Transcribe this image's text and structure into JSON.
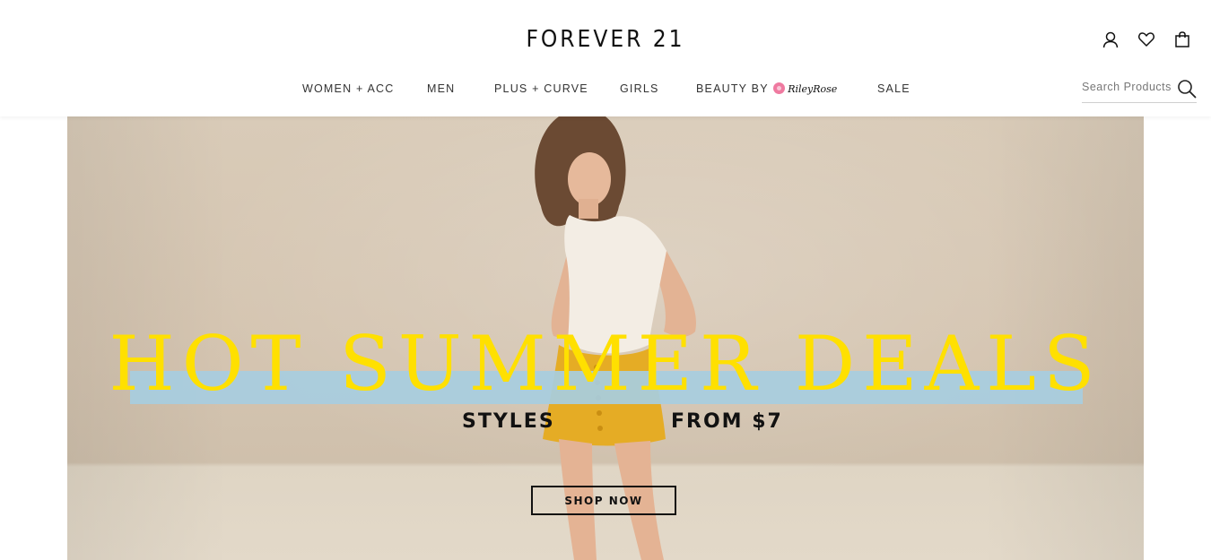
{
  "brand": {
    "logo_text": "FOREVER 21"
  },
  "utility": {
    "icons": [
      "account-icon",
      "wishlist-heart-icon",
      "shopping-bag-icon"
    ]
  },
  "nav": {
    "items": [
      {
        "label": "WOMEN + ACC"
      },
      {
        "label": "MEN"
      },
      {
        "label": "PLUS + CURVE"
      },
      {
        "label": "GIRLS"
      },
      {
        "label": "BEAUTY BY",
        "partner": "RileyRose"
      },
      {
        "label": "SALE"
      }
    ]
  },
  "search": {
    "placeholder": "Search Products",
    "value": ""
  },
  "hero": {
    "headline": "HOT SUMMER DEALS",
    "sub_left": "STYLES",
    "sub_right": "FROM $7",
    "cta": "SHOP NOW",
    "colors": {
      "headline": "#ffe000",
      "band": "#a7cde0",
      "background": "#d6c7b3"
    }
  }
}
